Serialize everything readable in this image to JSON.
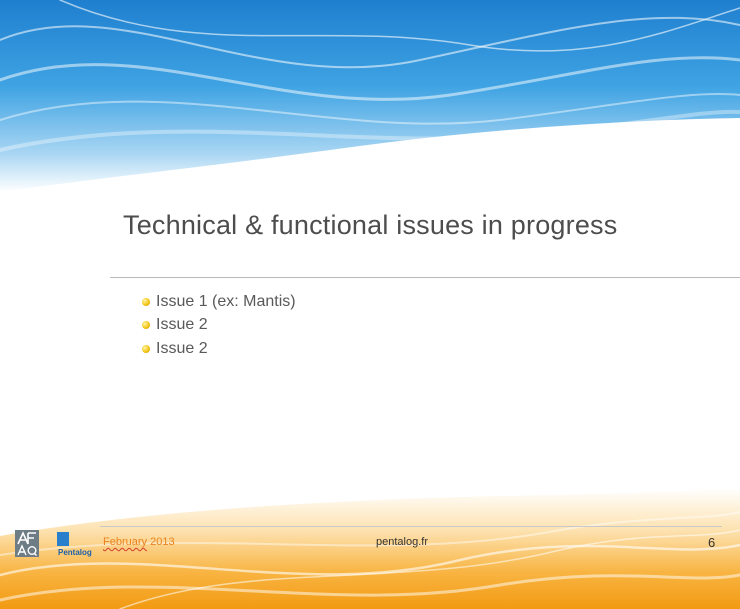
{
  "slide": {
    "title": "Technical & functional issues in progress",
    "bullets": [
      {
        "text": "Issue 1 (ex: Mantis)"
      },
      {
        "text": "Issue 2"
      },
      {
        "text": "Issue 2"
      }
    ]
  },
  "footer": {
    "date_month": "February",
    "date_year": "2013",
    "website": "pentalog.fr",
    "page_number": "6",
    "logos": {
      "afaq_text": "AFAQ",
      "pentalog_text": "Pentalog"
    }
  },
  "colors": {
    "top_wave": "#2b8fd8",
    "bottom_wave": "#f5a31c",
    "title_text": "#4d4d4d",
    "bullet": "#f3c516",
    "date_text": "#e8821e"
  }
}
